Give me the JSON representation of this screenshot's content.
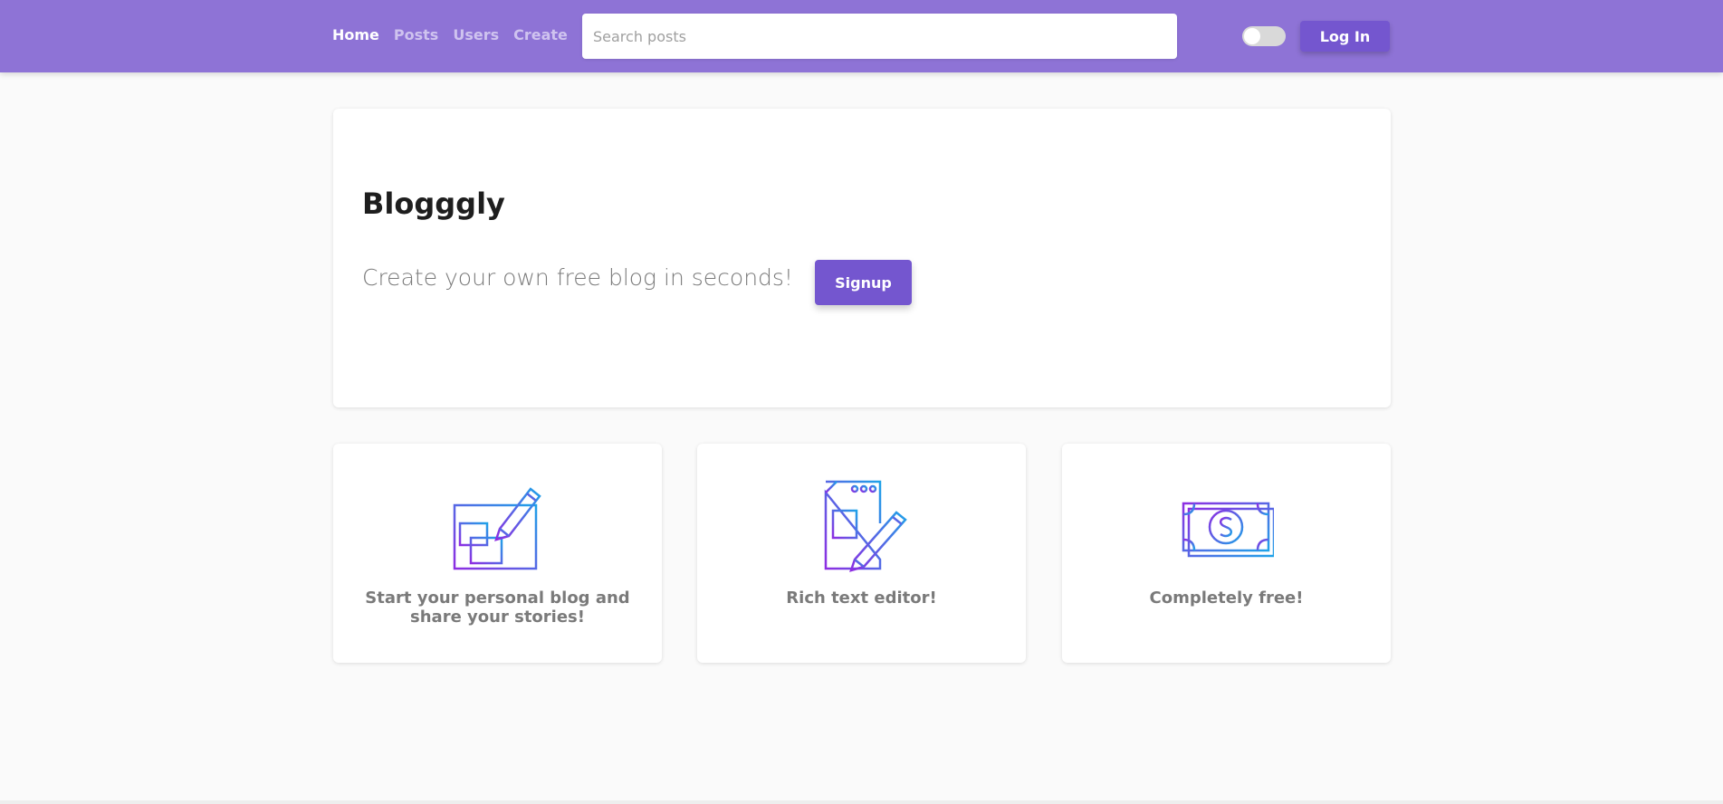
{
  "navbar": {
    "links": [
      {
        "label": "Home",
        "active": true
      },
      {
        "label": "Posts",
        "active": false
      },
      {
        "label": "Users",
        "active": false
      },
      {
        "label": "Create",
        "active": false
      }
    ],
    "search_placeholder": "Search posts",
    "search_value": "",
    "theme_toggle_on": false,
    "login_label": "Log In"
  },
  "hero": {
    "title": "Blogggly",
    "subtitle": "Create your own free blog in seconds!",
    "signup_label": "Signup"
  },
  "features": [
    {
      "icon": "blog-edit-icon",
      "text": "Start your personal blog and share your stories!"
    },
    {
      "icon": "document-pencil-icon",
      "text": "Rich text editor!"
    },
    {
      "icon": "money-bill-icon",
      "text": "Completely free!"
    }
  ],
  "colors": {
    "navbar": "#8e73d6",
    "primary_button": "#7456cf",
    "icon_gradient_start": "#7b3fe4",
    "icon_gradient_end": "#1f9fe0"
  }
}
